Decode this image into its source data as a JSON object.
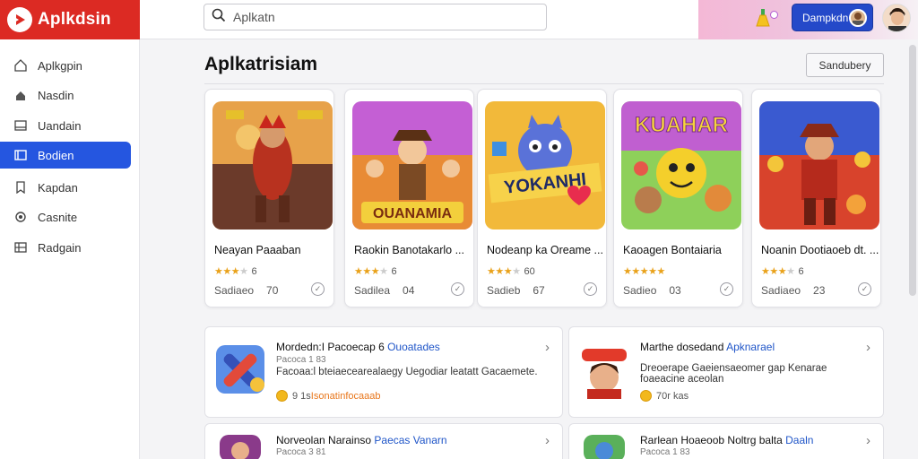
{
  "brand": {
    "name": "Aplkdsin"
  },
  "search": {
    "placeholder": "Aplkatn"
  },
  "header": {
    "user_button": "Dampkdn"
  },
  "sidebar": {
    "items": [
      {
        "label": "Aplkgpin",
        "icon": "home-icon"
      },
      {
        "label": "Nasdin",
        "icon": "person-icon"
      },
      {
        "label": "Uandain",
        "icon": "folder-icon"
      },
      {
        "label": "Bodien",
        "icon": "monitor-icon",
        "active": true
      },
      {
        "label": "Kapdan",
        "icon": "bookmark-icon"
      },
      {
        "label": "Casnite",
        "icon": "settings-icon"
      },
      {
        "label": "Radgain",
        "icon": "grid-icon"
      }
    ]
  },
  "main": {
    "title": "Aplkatrisiam",
    "sort_label": "Sandubery"
  },
  "cards": [
    {
      "title": "Neayan Paaaban",
      "rating": "6",
      "meta_label": "Sadiaeo",
      "meta_value": "70"
    },
    {
      "title": "Raokin Banotakarlo ...",
      "rating": "6",
      "meta_label": "Sadilea",
      "meta_value": "04"
    },
    {
      "title": "Nodeanp ka Oreame ...",
      "rating": "60",
      "meta_label": "Sadieb",
      "meta_value": "67"
    },
    {
      "title": "Kaoagen Bontaiaria",
      "rating": "",
      "meta_label": "Sadieo",
      "meta_value": "03"
    },
    {
      "title": "Noanin Dootiaoeb dt. ...",
      "rating": "6",
      "meta_label": "Sadiaeo",
      "meta_value": "23"
    }
  ],
  "list_cards": [
    {
      "title": "Mordedn:I Pacoecap 6 ",
      "title_accent": "Ouoatades",
      "sub": "Pacoca 1 83",
      "desc": "Facoaa:l bteiaecearealaegy Uegodiar leatatt Gacaemete.",
      "foot": "9 1s ",
      "foot_accent": "Isonatinfocaaab"
    },
    {
      "title": "Marthe dosedand ",
      "title_accent": "Apknarael",
      "sub": "",
      "desc": "Dreoerape Gaeiensaeomer gap Kenarae foaeacine aceolan",
      "foot": "70r kas",
      "foot_accent": ""
    },
    {
      "title": "Norveolan Narainso ",
      "title_accent": "Paecas Vanarn",
      "sub": "Pacoca 3 81",
      "desc": "",
      "foot": "",
      "foot_accent": ""
    },
    {
      "title": "Rarlean Hoaeoob Noltrg balta ",
      "title_accent": "Daaln",
      "sub": "Pacoca 1 83",
      "desc": "",
      "foot": "",
      "foot_accent": ""
    }
  ]
}
